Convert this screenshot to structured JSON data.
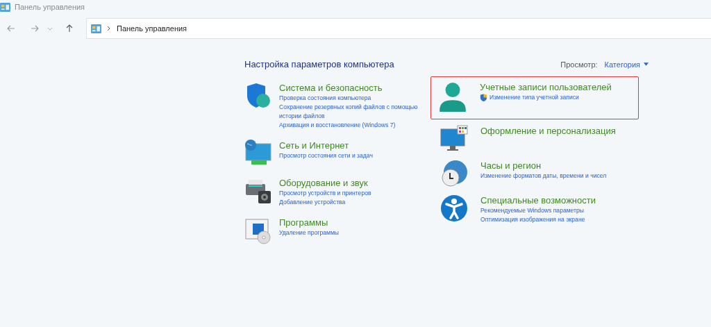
{
  "window": {
    "title": "Панель управления"
  },
  "address_bar": {
    "path": "Панель управления"
  },
  "heading": "Настройка параметров компьютера",
  "view": {
    "label": "Просмотр:",
    "value": "Категория"
  },
  "columns": [
    [
      {
        "kind": "shield",
        "title": "Система и безопасность",
        "highlighted": false,
        "links": [
          {
            "text": "Проверка состояния компьютера",
            "shield": false
          },
          {
            "text": "Сохранение резервных копий файлов с помощью истории файлов",
            "shield": false
          },
          {
            "text": "Архивация и восстановление (Windows 7)",
            "shield": false
          }
        ]
      },
      {
        "kind": "network",
        "title": "Сеть и Интернет",
        "highlighted": false,
        "links": [
          {
            "text": "Просмотр состояния сети и задач",
            "shield": false
          }
        ]
      },
      {
        "kind": "printer",
        "title": "Оборудование и звук",
        "highlighted": false,
        "links": [
          {
            "text": "Просмотр устройств и принтеров",
            "shield": false
          },
          {
            "text": "Добавление устройства",
            "shield": false
          }
        ]
      },
      {
        "kind": "programs",
        "title": "Программы",
        "highlighted": false,
        "links": [
          {
            "text": "Удаление программы",
            "shield": false
          }
        ]
      }
    ],
    [
      {
        "kind": "user",
        "title": "Учетные записи пользователей",
        "highlighted": true,
        "links": [
          {
            "text": "Изменение типа учетной записи",
            "shield": true
          }
        ]
      },
      {
        "kind": "display",
        "title": "Оформление и персонализация",
        "highlighted": false
      },
      {
        "kind": "clock",
        "title": "Часы и регион",
        "highlighted": false,
        "links": [
          {
            "text": "Изменение форматов даты, времени и чисел",
            "shield": false
          }
        ]
      },
      {
        "kind": "access",
        "title": "Специальные возможности",
        "highlighted": false,
        "links": [
          {
            "text": "Рекомендуемые Windows параметры",
            "shield": false
          },
          {
            "text": "Оптимизация изображения на экране",
            "shield": false
          }
        ]
      }
    ]
  ]
}
